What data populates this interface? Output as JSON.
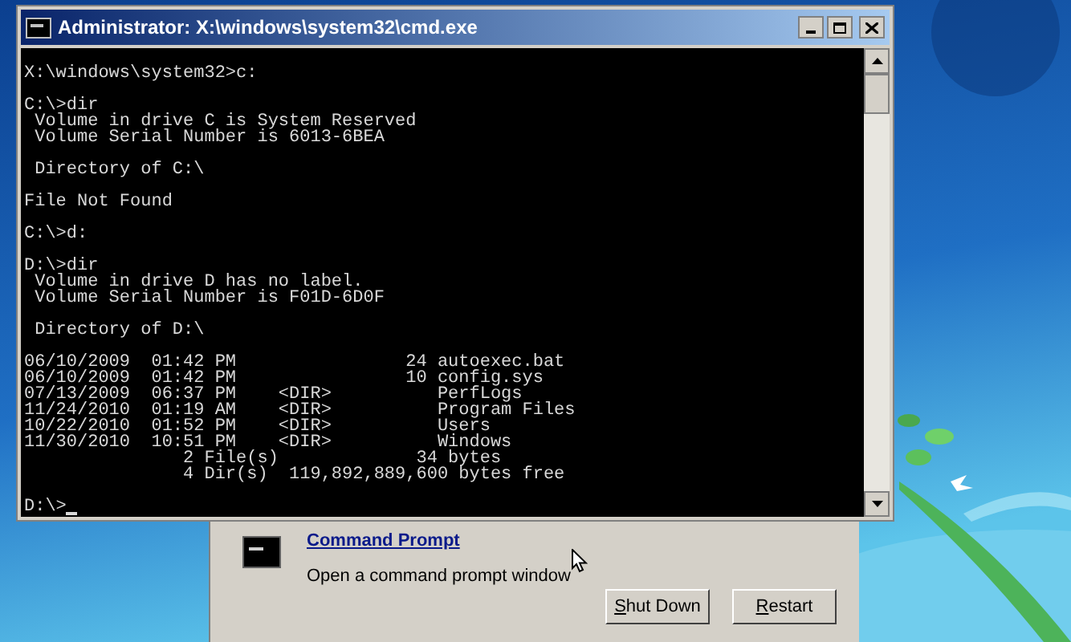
{
  "window": {
    "title": "Administrator: X:\\windows\\system32\\cmd.exe"
  },
  "console": {
    "blocks": [
      [
        "X:\\windows\\system32>c:"
      ],
      [
        "C:\\>dir",
        " Volume in drive C is System Reserved",
        " Volume Serial Number is 6013-6BEA"
      ],
      [
        " Directory of C:\\"
      ],
      [
        "File Not Found"
      ],
      [
        "C:\\>d:"
      ],
      [
        "D:\\>dir",
        " Volume in drive D has no label.",
        " Volume Serial Number is F01D-6D0F"
      ],
      [
        " Directory of D:\\"
      ],
      [
        "06/10/2009  01:42 PM                24 autoexec.bat",
        "06/10/2009  01:42 PM                10 config.sys",
        "07/13/2009  06:37 PM    <DIR>          PerfLogs",
        "11/24/2010  01:19 AM    <DIR>          Program Files",
        "10/22/2010  01:52 PM    <DIR>          Users",
        "11/30/2010  10:51 PM    <DIR>          Windows",
        "               2 File(s)             34 bytes",
        "               4 Dir(s)  119,892,889,600 bytes free"
      ],
      [
        "D:\\>"
      ]
    ],
    "cursor": true
  },
  "option": {
    "title": "Command Prompt",
    "description": "Open a command prompt window"
  },
  "buttons": [
    {
      "label": "Shut Down",
      "first_letter_underlined": true
    },
    {
      "label": "Restart",
      "first_letter_underlined": true
    }
  ]
}
